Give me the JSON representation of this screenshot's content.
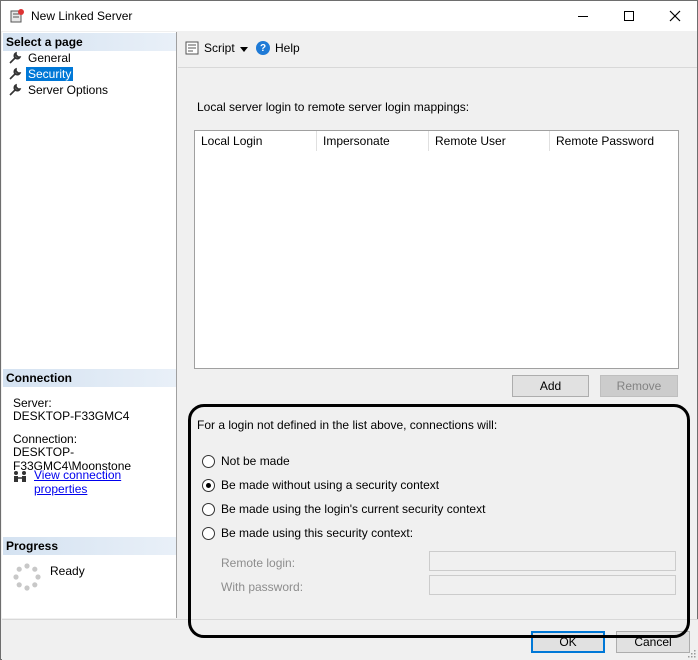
{
  "window": {
    "title": "New Linked Server"
  },
  "left_pane": {
    "select_page_header": "Select a page",
    "pages": [
      {
        "label": "General"
      },
      {
        "label": "Security"
      },
      {
        "label": "Server Options"
      }
    ],
    "connection_header": "Connection",
    "server_label": "Server:",
    "server_value": "DESKTOP-F33GMC4",
    "connection_label": "Connection:",
    "connection_value": "DESKTOP-F33GMC4\\Moonstone",
    "view_connection_link": "View connection properties",
    "progress_header": "Progress",
    "progress_status": "Ready"
  },
  "toolbar": {
    "script_label": "Script",
    "help_label": "Help"
  },
  "security": {
    "mapping_label": "Local server login to remote server login mappings:",
    "columns": [
      "Local Login",
      "Impersonate",
      "Remote User",
      "Remote Password"
    ],
    "add_label": "Add",
    "remove_label": "Remove",
    "frame_label": "For a login not defined in the list above, connections will:",
    "options": [
      {
        "label": "Not be made",
        "checked": false
      },
      {
        "label": "Be made without using a security context",
        "checked": true
      },
      {
        "label": "Be made using the login's current security context",
        "checked": false
      },
      {
        "label": "Be made using this security context:",
        "checked": false
      }
    ],
    "remote_login_label": "Remote login:",
    "remote_login_value": "",
    "with_password_label": "With password:",
    "with_password_value": ""
  },
  "footer": {
    "ok_label": "OK",
    "cancel_label": "Cancel"
  },
  "colors": {
    "selection": "#0078d7",
    "link": "#0000ee",
    "help_icon": "#1e7ad6"
  }
}
